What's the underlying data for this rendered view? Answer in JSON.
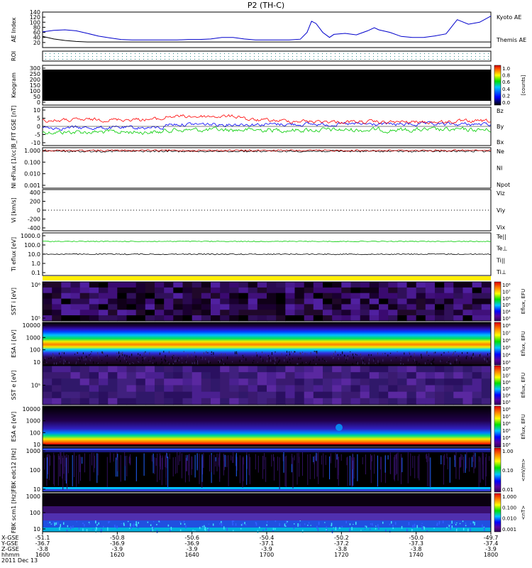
{
  "title": "P2 (TH-C)",
  "colors": {
    "kyoto": "#0000cc",
    "themis": "#000000",
    "bz": "#ff0000",
    "by": "#00cc00",
    "bx": "#0000ff",
    "ne": "#cc0000",
    "te": "#00cc00"
  },
  "chart_data": [
    {
      "id": "ae",
      "type": "line",
      "ylabel": "AE Index",
      "yticks": [
        "140",
        "120",
        "100",
        "80",
        "60",
        "40",
        "20"
      ],
      "ylim": [
        0,
        140
      ],
      "x": [
        1600,
        1605,
        1610,
        1615,
        1620,
        1625,
        1630,
        1635,
        1640,
        1645,
        1650,
        1655,
        1660,
        1665,
        1670,
        1675,
        1680,
        1685,
        1690,
        1695,
        1700,
        1705,
        1710,
        1715,
        1718,
        1720,
        1722,
        1725,
        1728,
        1730,
        1735,
        1740,
        1745,
        1748,
        1750,
        1755,
        1760,
        1765,
        1770,
        1775,
        1780,
        1785,
        1790,
        1795,
        1800
      ],
      "series": [
        {
          "name": "Kyoto AE",
          "color": "#0000cc",
          "values": [
            62,
            68,
            70,
            66,
            56,
            45,
            38,
            32,
            30,
            30,
            30,
            30,
            30,
            32,
            32,
            34,
            40,
            40,
            34,
            30,
            30,
            30,
            30,
            33,
            60,
            104,
            95,
            60,
            40,
            52,
            56,
            50,
            66,
            78,
            70,
            60,
            44,
            40,
            40,
            46,
            54,
            110,
            92,
            100,
            124
          ]
        },
        {
          "name": "Themis AE",
          "color": "#000000",
          "values": [
            44,
            34,
            28,
            24,
            22,
            22,
            22,
            22,
            22,
            22,
            22,
            22,
            22,
            22,
            22,
            22,
            22,
            22,
            22,
            22,
            22,
            22,
            22,
            22,
            22,
            22,
            22,
            22,
            22,
            22,
            22,
            22,
            22,
            22,
            22,
            22,
            22,
            22,
            22,
            22,
            22,
            22,
            22,
            22,
            22
          ]
        }
      ]
    },
    {
      "id": "roi",
      "type": "heatmap",
      "ylabel": "ROI"
    },
    {
      "id": "keogram",
      "type": "heatmap",
      "ylabel": "Keogram",
      "yticks": [
        "300",
        "250",
        "200",
        "150",
        "100",
        "50",
        "0"
      ],
      "colorbar": {
        "label": "[counts]",
        "ticks": [
          "1.0",
          "0.8",
          "0.6",
          "0.4",
          "0.2",
          "0.0"
        ]
      }
    },
    {
      "id": "bfield",
      "type": "line",
      "ylabel": "B_FIT GSE [nT]",
      "yticks": [
        "10",
        "5",
        "0",
        "-5",
        "-10"
      ],
      "series": [
        {
          "name": "Bz",
          "color": "#ff0000"
        },
        {
          "name": "By",
          "color": "#00cc00"
        },
        {
          "name": "Bx",
          "color": "#0000ff"
        }
      ]
    },
    {
      "id": "density",
      "type": "line",
      "ylabel": "NI eFlux [1/cc]",
      "yticks": [
        "1.000",
        "0.100",
        "0.010",
        "0.001"
      ],
      "series": [
        {
          "name": "Ne",
          "color": "#cc0000"
        },
        {
          "name": "NI",
          "color": "#000000"
        },
        {
          "name": "Npot",
          "color": "#000088"
        }
      ]
    },
    {
      "id": "velocity",
      "type": "line",
      "ylabel": "Vi [km/s]",
      "yticks": [
        "400",
        "200",
        "0",
        "-200",
        "-400"
      ],
      "series": [
        {
          "name": "Viz",
          "color": "#cc0000"
        },
        {
          "name": "Viy",
          "color": "#00cc00"
        },
        {
          "name": "Vix",
          "color": "#0000cc"
        }
      ]
    },
    {
      "id": "temperature",
      "type": "line",
      "ylabel": "Ti eflux [eV]",
      "yticks": [
        "1000.0",
        "100.0",
        "10.0",
        "1.0",
        "0.1"
      ],
      "series": [
        {
          "name": "Te||",
          "color": "#000000"
        },
        {
          "name": "Te⊥",
          "color": "#cc0000"
        },
        {
          "name": "Ti||",
          "color": "#00cc00"
        },
        {
          "name": "Ti⊥",
          "color": "#0000cc"
        }
      ]
    },
    {
      "id": "sst_i",
      "type": "heatmap",
      "ylabel": "SST i [eV]",
      "yticks": [
        "10⁶",
        "10⁵"
      ],
      "colorbar": {
        "label": "Eflux, EFU",
        "ticks": [
          "10⁸",
          "10⁷",
          "10⁶",
          "10⁵",
          "10⁴",
          "10³"
        ]
      }
    },
    {
      "id": "esa_i",
      "type": "heatmap",
      "ylabel": "ESA i [eV]",
      "yticks": [
        "10000",
        "1000",
        "100",
        "10"
      ],
      "colorbar": {
        "label": "Eflux, EFU",
        "ticks": [
          "10⁸",
          "10⁷",
          "10⁶",
          "10⁵",
          "10⁴",
          "10³"
        ]
      }
    },
    {
      "id": "sst_e",
      "type": "heatmap",
      "ylabel": "SST e [eV]",
      "yticks": [
        "10⁵"
      ],
      "colorbar": {
        "label": "Eflux, EFU",
        "ticks": [
          "10⁸",
          "10⁷",
          "10⁶",
          "10⁵",
          "10⁴",
          "10³"
        ]
      }
    },
    {
      "id": "esa_e",
      "type": "heatmap",
      "ylabel": "ESA e [eV]",
      "yticks": [
        "10000",
        "1000",
        "100",
        "10"
      ],
      "colorbar": {
        "label": "Eflux, EFU",
        "ticks": [
          "10⁸",
          "10⁷",
          "10⁶",
          "10⁵",
          "10⁴",
          "10³"
        ]
      }
    },
    {
      "id": "fbk_e",
      "type": "heatmap",
      "ylabel": "FBK edc12 [Hz]",
      "yticks": [
        "1000",
        "100",
        "10"
      ],
      "colorbar": {
        "label": "<mV/m>",
        "ticks": [
          "1.00",
          "0.10",
          "0.01"
        ]
      }
    },
    {
      "id": "fbk_b",
      "type": "heatmap",
      "ylabel": "FBK scm1 [Hz]",
      "yticks": [
        "1000",
        "100",
        "10"
      ],
      "colorbar": {
        "label": "<nT>",
        "ticks": [
          "1.000",
          "0.100",
          "0.010",
          "0.001"
        ]
      }
    }
  ],
  "xaxis": {
    "row_labels": [
      "X-GSE",
      "Y-GSE",
      "Z-GSE",
      "hhmm",
      "2011 Dec 13"
    ],
    "ticks": [
      {
        "x": "-51.1",
        "y": "-36.7",
        "z": "-3.8",
        "t": "1600"
      },
      {
        "x": "-50.8",
        "y": "-36.9",
        "z": "-3.9",
        "t": "1620"
      },
      {
        "x": "-50.6",
        "y": "-36.9",
        "z": "-3.9",
        "t": "1640"
      },
      {
        "x": "-50.4",
        "y": "-37.1",
        "z": "-3.9",
        "t": "1700"
      },
      {
        "x": "-50.2",
        "y": "-37.2",
        "z": "-3.8",
        "t": "1720"
      },
      {
        "x": "-50.0",
        "y": "-37.3",
        "z": "-3.8",
        "t": "1740"
      },
      {
        "x": "-49.7",
        "y": "-37.4",
        "z": "-3.9",
        "t": "1800"
      }
    ]
  }
}
